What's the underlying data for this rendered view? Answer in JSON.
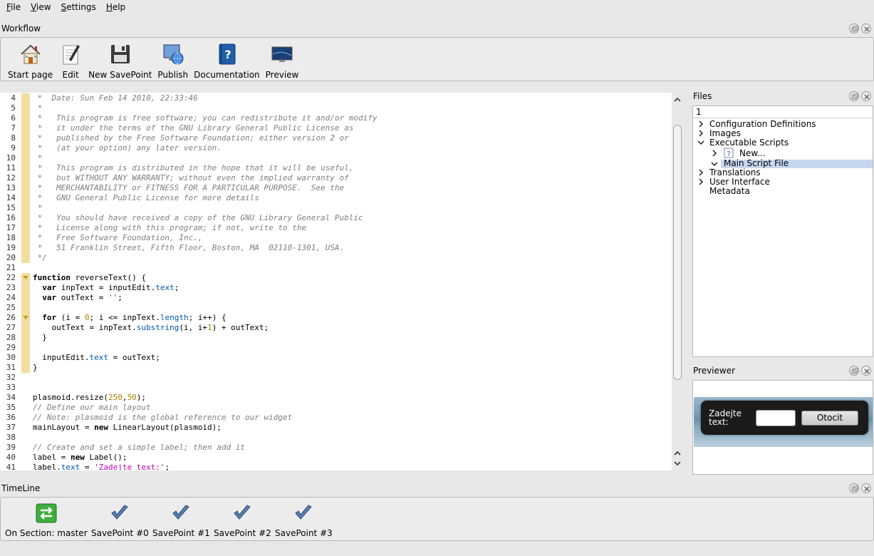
{
  "menubar": {
    "items": [
      {
        "label": "File",
        "mnemonic": "F",
        "rest": "ile"
      },
      {
        "label": "View",
        "mnemonic": "V",
        "rest": "iew"
      },
      {
        "label": "Settings",
        "mnemonic": "S",
        "rest": "ettings"
      },
      {
        "label": "Help",
        "mnemonic": "H",
        "rest": "elp"
      }
    ]
  },
  "workflow": {
    "title": "Workflow",
    "tools": [
      {
        "label": "Start page",
        "icon": "house-icon"
      },
      {
        "label": "Edit",
        "icon": "edit-document-icon"
      },
      {
        "label": "New SavePoint",
        "icon": "floppy-disk-icon"
      },
      {
        "label": "Publish",
        "icon": "globe-computer-icon"
      },
      {
        "label": "Documentation",
        "icon": "help-book-icon"
      },
      {
        "label": "Preview",
        "icon": "monitor-icon"
      }
    ]
  },
  "editor": {
    "lines": [
      {
        "n": "4",
        "segs": [
          {
            "t": " *  Date: Sun Feb 14 2010, 22:33:46",
            "c": "cm"
          }
        ]
      },
      {
        "n": "5",
        "segs": [
          {
            "t": " *",
            "c": "cm"
          }
        ]
      },
      {
        "n": "6",
        "segs": [
          {
            "t": " *   This program is free software; you can redistribute it and/or modify",
            "c": "cm"
          }
        ]
      },
      {
        "n": "7",
        "segs": [
          {
            "t": " *   it under the terms of the GNU Library General Public License as",
            "c": "cm"
          }
        ]
      },
      {
        "n": "8",
        "segs": [
          {
            "t": " *   published by the Free Software Foundation; either version 2 or",
            "c": "cm"
          }
        ]
      },
      {
        "n": "9",
        "segs": [
          {
            "t": " *   (at your option) any later version.",
            "c": "cm"
          }
        ]
      },
      {
        "n": "10",
        "segs": [
          {
            "t": " *",
            "c": "cm"
          }
        ]
      },
      {
        "n": "11",
        "segs": [
          {
            "t": " *   This program is distributed in the hope that it will be useful,",
            "c": "cm"
          }
        ]
      },
      {
        "n": "12",
        "segs": [
          {
            "t": " *   but WITHOUT ANY WARRANTY; without even the implied warranty of",
            "c": "cm"
          }
        ]
      },
      {
        "n": "13",
        "segs": [
          {
            "t": " *   MERCHANTABILITY or FITNESS FOR A PARTICULAR PURPOSE.  See the",
            "c": "cm"
          }
        ]
      },
      {
        "n": "14",
        "segs": [
          {
            "t": " *   GNU General Public License for more details",
            "c": "cm"
          }
        ]
      },
      {
        "n": "15",
        "segs": [
          {
            "t": " *",
            "c": "cm"
          }
        ]
      },
      {
        "n": "16",
        "segs": [
          {
            "t": " *   You should have received a copy of the GNU Library General Public",
            "c": "cm"
          }
        ]
      },
      {
        "n": "17",
        "segs": [
          {
            "t": " *   License along with this program; if not, write to the",
            "c": "cm"
          }
        ]
      },
      {
        "n": "18",
        "segs": [
          {
            "t": " *   Free Software Foundation, Inc.,",
            "c": "cm"
          }
        ]
      },
      {
        "n": "19",
        "segs": [
          {
            "t": " *   51 Franklin Street, Fifth Floor, Boston, MA  02110-1301, USA.",
            "c": "cm"
          }
        ]
      },
      {
        "n": "20",
        "segs": [
          {
            "t": " */",
            "c": "cm"
          }
        ]
      },
      {
        "n": "21",
        "segs": []
      },
      {
        "n": "22",
        "fold": true,
        "segs": [
          {
            "t": "function",
            "c": "kw"
          },
          {
            "t": " reverseText() {",
            "c": ""
          }
        ]
      },
      {
        "n": "23",
        "segs": [
          {
            "t": "  ",
            "c": ""
          },
          {
            "t": "var",
            "c": "kw"
          },
          {
            "t": " inpText = inputEdit.",
            "c": ""
          },
          {
            "t": "text",
            "c": "prop"
          },
          {
            "t": ";",
            "c": ""
          }
        ]
      },
      {
        "n": "24",
        "segs": [
          {
            "t": "  ",
            "c": ""
          },
          {
            "t": "var",
            "c": "kw"
          },
          {
            "t": " outText = ",
            "c": ""
          },
          {
            "t": "''",
            "c": "str"
          },
          {
            "t": ";",
            "c": ""
          }
        ]
      },
      {
        "n": "25",
        "segs": []
      },
      {
        "n": "26",
        "fold": true,
        "segs": [
          {
            "t": "  ",
            "c": ""
          },
          {
            "t": "for",
            "c": "kw"
          },
          {
            "t": " (i = ",
            "c": ""
          },
          {
            "t": "0",
            "c": "num"
          },
          {
            "t": "; i <= inpText.",
            "c": ""
          },
          {
            "t": "length",
            "c": "prop"
          },
          {
            "t": "; i++) {",
            "c": ""
          }
        ]
      },
      {
        "n": "27",
        "segs": [
          {
            "t": "    outText = inpText.",
            "c": ""
          },
          {
            "t": "substring",
            "c": "prop"
          },
          {
            "t": "(i, i+",
            "c": ""
          },
          {
            "t": "1",
            "c": "num"
          },
          {
            "t": ") + outText;",
            "c": ""
          }
        ]
      },
      {
        "n": "28",
        "segs": [
          {
            "t": "  }",
            "c": ""
          }
        ]
      },
      {
        "n": "29",
        "segs": []
      },
      {
        "n": "30",
        "segs": [
          {
            "t": "  inputEdit.",
            "c": ""
          },
          {
            "t": "text",
            "c": "prop"
          },
          {
            "t": " = outText;",
            "c": ""
          }
        ]
      },
      {
        "n": "31",
        "segs": [
          {
            "t": "}",
            "c": ""
          }
        ]
      },
      {
        "n": "32",
        "segs": []
      },
      {
        "n": "33",
        "segs": []
      },
      {
        "n": "34",
        "segs": [
          {
            "t": "plasmoid.resize(",
            "c": ""
          },
          {
            "t": "250",
            "c": "num"
          },
          {
            "t": ",",
            "c": ""
          },
          {
            "t": "50",
            "c": "num"
          },
          {
            "t": ");",
            "c": ""
          }
        ]
      },
      {
        "n": "35",
        "segs": [
          {
            "t": "// Define our main layout",
            "c": "cm"
          }
        ]
      },
      {
        "n": "36",
        "segs": [
          {
            "t": "// Note: plasmoid is the global reference to our widget",
            "c": "cm"
          }
        ]
      },
      {
        "n": "37",
        "segs": [
          {
            "t": "mainLayout = ",
            "c": ""
          },
          {
            "t": "new",
            "c": "kw"
          },
          {
            "t": " LinearLayout(plasmoid);",
            "c": ""
          }
        ]
      },
      {
        "n": "38",
        "segs": []
      },
      {
        "n": "39",
        "segs": [
          {
            "t": "// Create and set a simple label; then add it",
            "c": "cm"
          }
        ]
      },
      {
        "n": "40",
        "segs": [
          {
            "t": "label = ",
            "c": ""
          },
          {
            "t": "new",
            "c": "kw"
          },
          {
            "t": " Label();",
            "c": ""
          }
        ]
      },
      {
        "n": "41",
        "segs": [
          {
            "t": "label.",
            "c": ""
          },
          {
            "t": "text",
            "c": "prop"
          },
          {
            "t": " = ",
            "c": ""
          },
          {
            "t": "'Zadejte text:'",
            "c": "str"
          },
          {
            "t": ";",
            "c": ""
          }
        ]
      }
    ]
  },
  "files": {
    "title": "Files",
    "combo_value": "1",
    "tree": [
      {
        "label": "Configuration Definitions",
        "arrow": "right",
        "indent": 0
      },
      {
        "label": "Images",
        "arrow": "right",
        "indent": 0
      },
      {
        "label": "Executable Scripts",
        "arrow": "down",
        "indent": 0
      },
      {
        "label": "New...",
        "arrow": "right",
        "indent": 1,
        "icon": "unknown-file-icon"
      },
      {
        "label": "Main Script File",
        "arrow": "down",
        "indent": 1,
        "selected": true
      },
      {
        "label": "Translations",
        "arrow": "right",
        "indent": 0
      },
      {
        "label": "User Interface",
        "arrow": "right",
        "indent": 0
      },
      {
        "label": "Metadata",
        "arrow": "",
        "indent": 0
      }
    ]
  },
  "previewer": {
    "title": "Previewer",
    "widget_label": "Zadejte text:",
    "widget_button": "Otocit",
    "widget_input_value": ""
  },
  "timeline": {
    "title": "TimeLine",
    "items": [
      {
        "label": "On Section: master",
        "icon": "switch-arrows-icon"
      },
      {
        "label": "SavePoint #0",
        "icon": "checkmark-icon"
      },
      {
        "label": "SavePoint #1",
        "icon": "checkmark-icon"
      },
      {
        "label": "SavePoint #2",
        "icon": "checkmark-icon"
      },
      {
        "label": "SavePoint #3",
        "icon": "checkmark-icon"
      }
    ]
  },
  "colors": {
    "fold_gutter": "#f3dea0",
    "comment": "#7f7f7f",
    "property": "#0057ae",
    "number": "#b08000",
    "string": "#bf03bf",
    "selection": "#c6d6ee"
  }
}
